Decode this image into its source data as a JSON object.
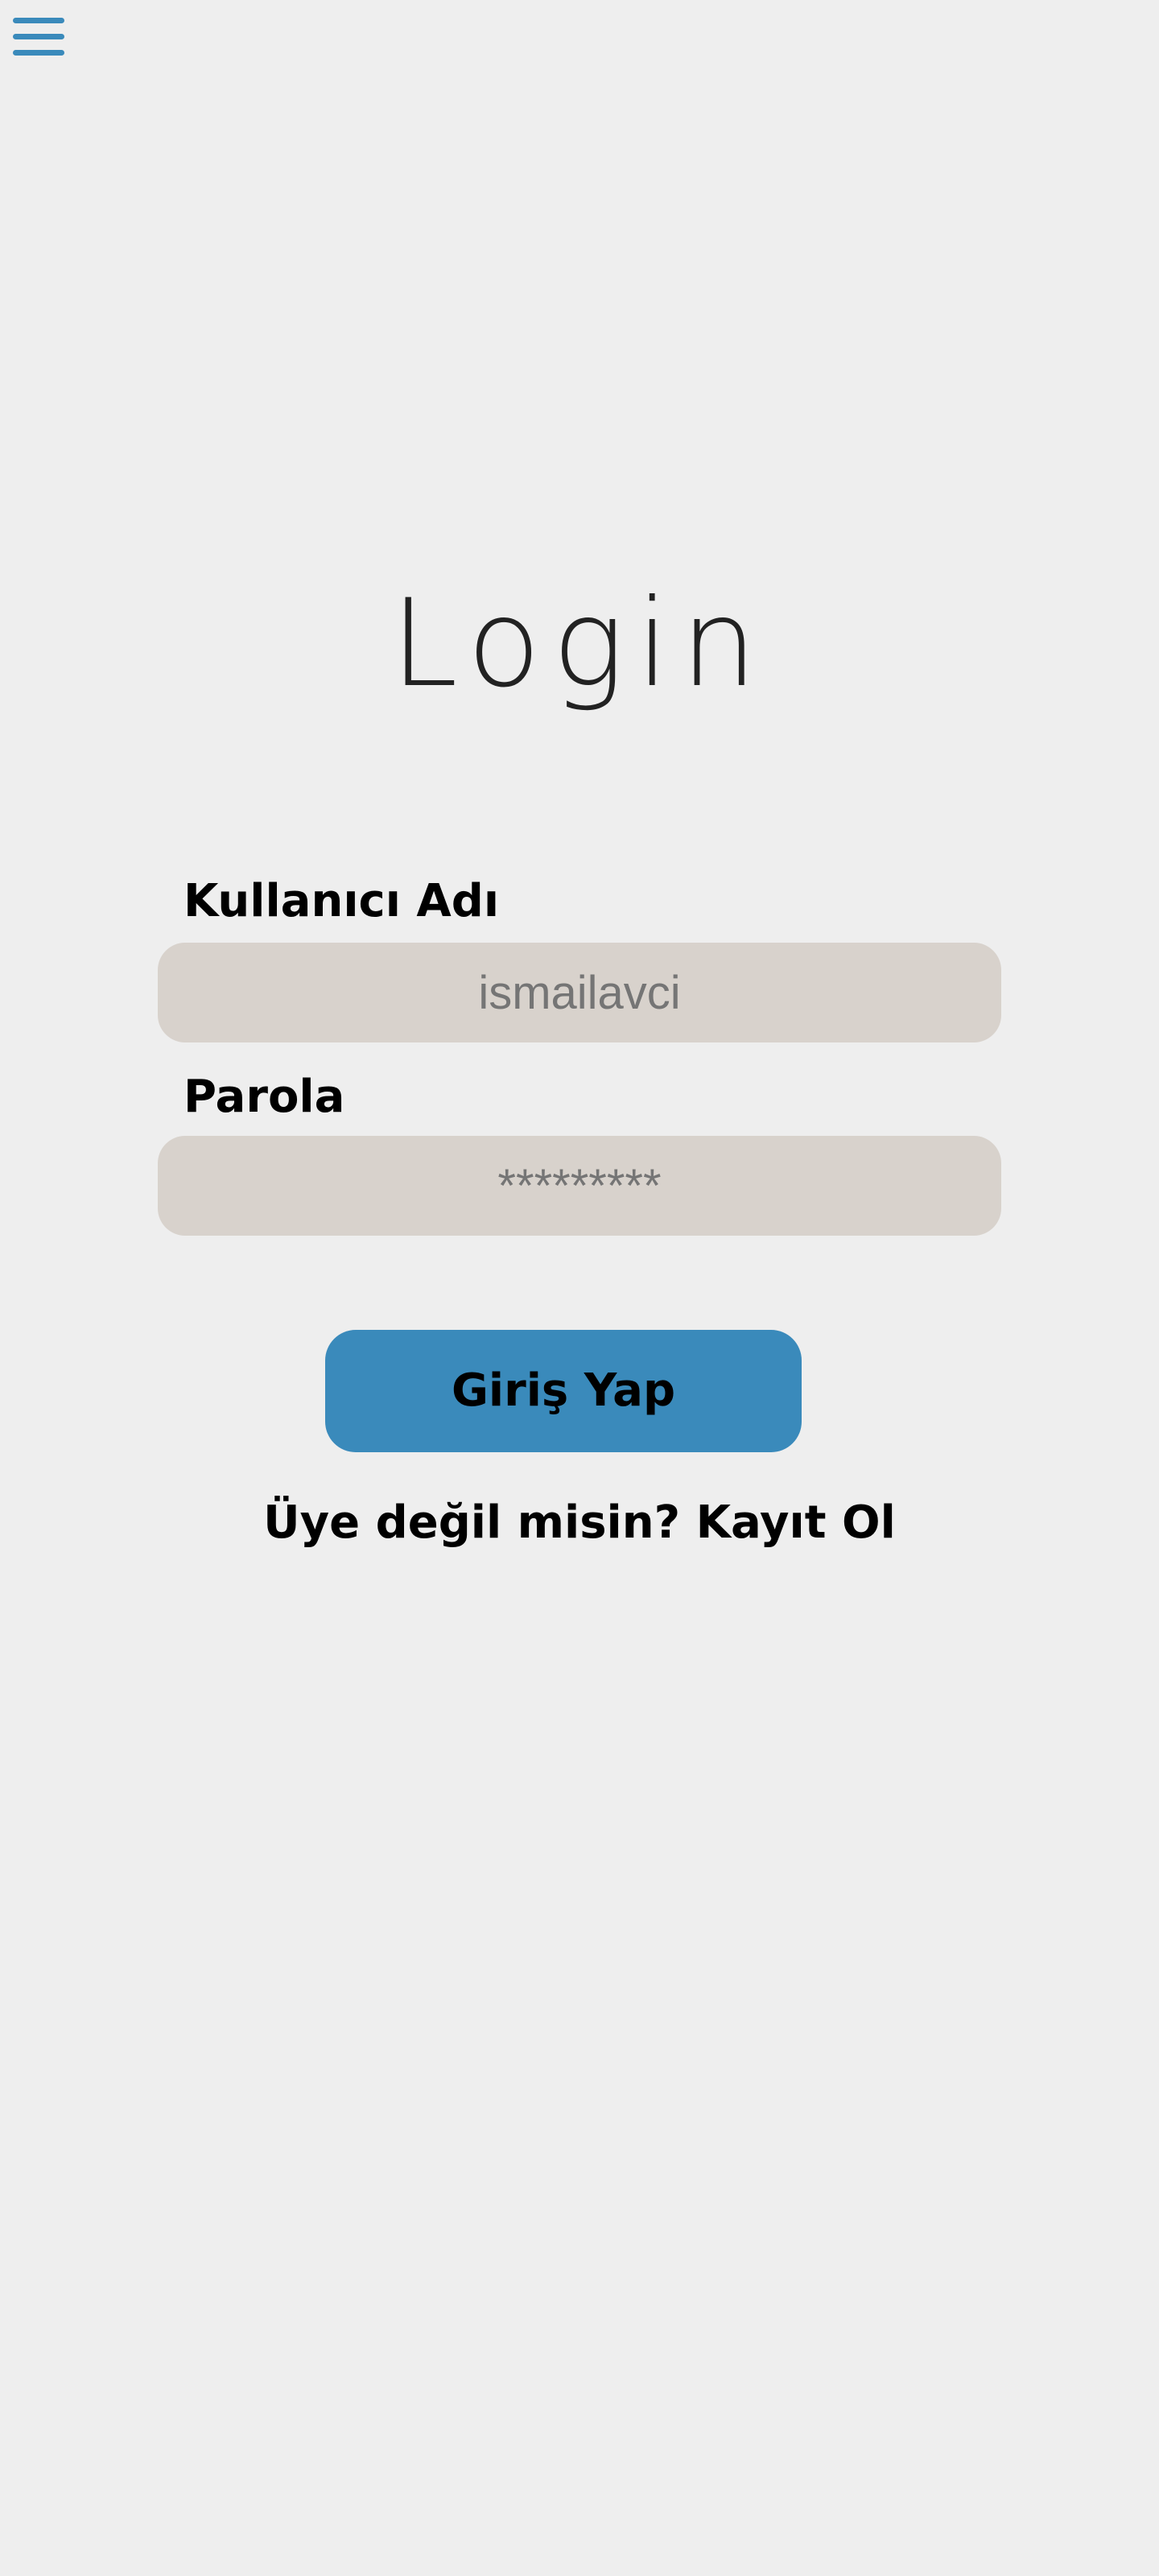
{
  "icons": {
    "menu": "hamburger-menu-icon"
  },
  "colors": {
    "background": "#eeeeee",
    "accent": "#3a8abb",
    "input_background": "#d8d2cc",
    "text": "#000000",
    "placeholder": "#6a6a6a"
  },
  "title": "Login",
  "form": {
    "username_label": "Kullanıcı Adı",
    "username_placeholder": "ismailavci",
    "username_value": "",
    "password_label": "Parola",
    "password_placeholder": "*********",
    "password_value": "",
    "submit_label": "Giriş Yap"
  },
  "register_link": "Üye değil misin? Kayıt Ol"
}
